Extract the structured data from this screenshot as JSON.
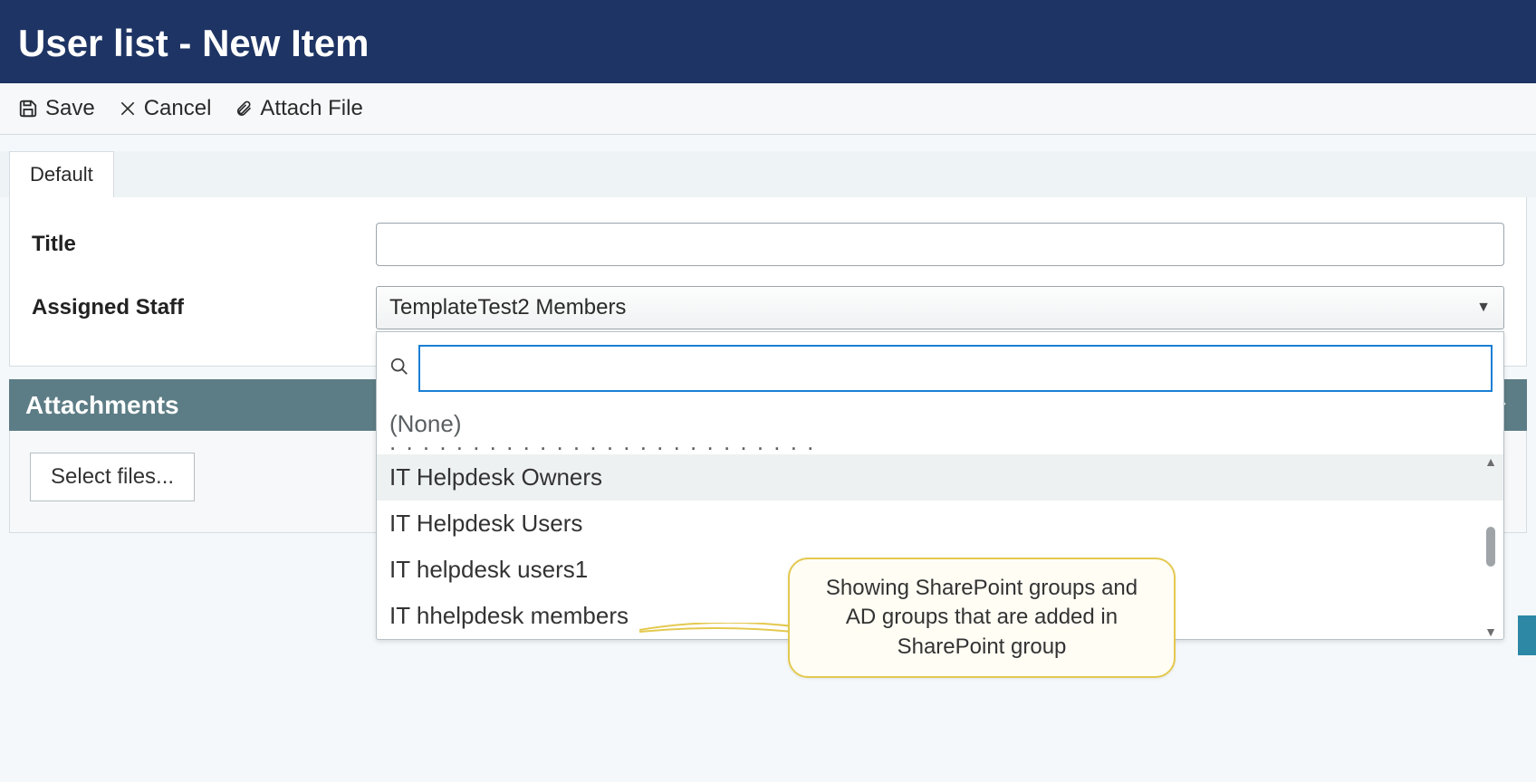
{
  "header": {
    "title": "User list - New Item"
  },
  "toolbar": {
    "save_label": "Save",
    "cancel_label": "Cancel",
    "attach_label": "Attach File"
  },
  "tabs": {
    "default_label": "Default"
  },
  "fields": {
    "title_label": "Title",
    "title_value": "",
    "assigned_label": "Assigned Staff",
    "assigned_selected": "TemplateTest2 Members"
  },
  "dropdown": {
    "search_value": "",
    "none_label": "(None)",
    "truncated_peek": ". . . . . . . . . . . . . . . . . . . . . . . . . .",
    "items": [
      "IT Helpdesk Owners",
      "IT Helpdesk Users",
      "IT helpdesk users1",
      "IT hhelpdesk members"
    ]
  },
  "attachments": {
    "header": "Attachments",
    "select_files": "Select files..."
  },
  "callout_text": "Showing SharePoint groups and AD groups that are added in SharePoint group"
}
